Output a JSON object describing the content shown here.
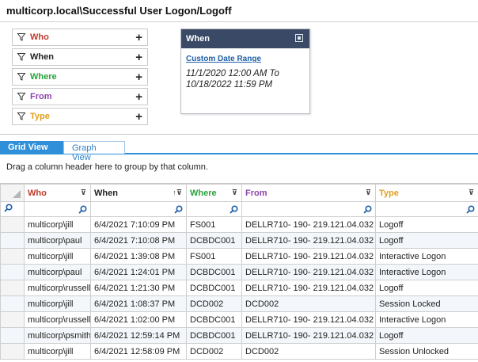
{
  "window": {
    "title": "multicorp.local\\Successful User Logon/Logoff"
  },
  "filters": [
    {
      "label": "Who",
      "color": "#c0392b"
    },
    {
      "label": "When",
      "color": "#222222"
    },
    {
      "label": "Where",
      "color": "#27a33a"
    },
    {
      "label": "From",
      "color": "#8e44ad"
    },
    {
      "label": "Type",
      "color": "#e0a020"
    }
  ],
  "when_panel": {
    "title": "When",
    "link": "Custom Date Range",
    "line1": "11/1/2020 12:00 AM To",
    "line2": "10/18/2022 11:59 PM"
  },
  "tabs": {
    "grid": "Grid View",
    "graph": "Graph View"
  },
  "group_hint": "Drag a column header here to group by that column.",
  "grid": {
    "columns": [
      {
        "label": "Who",
        "color": "#c0392b"
      },
      {
        "label": "When",
        "color": "#222222"
      },
      {
        "label": "Where",
        "color": "#27a33a"
      },
      {
        "label": "From",
        "color": "#8e44ad"
      },
      {
        "label": "Type",
        "color": "#e0a020"
      }
    ],
    "rows": [
      [
        "multicorp\\jill",
        "6/4/2021 7:10:09 PM",
        "FS001",
        "DELLR710- 190- 219.121.04.032",
        "Logoff"
      ],
      [
        "multicorp\\paul",
        "6/4/2021 7:10:08 PM",
        "DCBDC001",
        "DELLR710- 190- 219.121.04.032",
        "Logoff"
      ],
      [
        "multicorp\\jill",
        "6/4/2021 1:39:08 PM",
        "FS001",
        "DELLR710- 190- 219.121.04.032",
        "Interactive Logon"
      ],
      [
        "multicorp\\paul",
        "6/4/2021 1:24:01 PM",
        "DCBDC001",
        "DELLR710- 190- 219.121.04.032",
        "Interactive Logon"
      ],
      [
        "multicorp\\russell",
        "6/4/2021 1:21:30 PM",
        "DCBDC001",
        "DELLR710- 190- 219.121.04.032",
        "Logoff"
      ],
      [
        "multicorp\\jill",
        "6/4/2021 1:08:37 PM",
        "DCD002",
        "DCD002",
        "Session Locked"
      ],
      [
        "multicorp\\russell",
        "6/4/2021 1:02:00 PM",
        "DCBDC001",
        "DELLR710- 190- 219.121.04.032",
        "Interactive Logon"
      ],
      [
        "multicorp\\psmith",
        "6/4/2021 12:59:14 PM",
        "DCBDC001",
        "DELLR710- 190- 219.121.04.032",
        "Logoff"
      ],
      [
        "multicorp\\jill",
        "6/4/2021 12:58:09 PM",
        "DCD002",
        "DCD002",
        "Session Unlocked"
      ]
    ]
  }
}
